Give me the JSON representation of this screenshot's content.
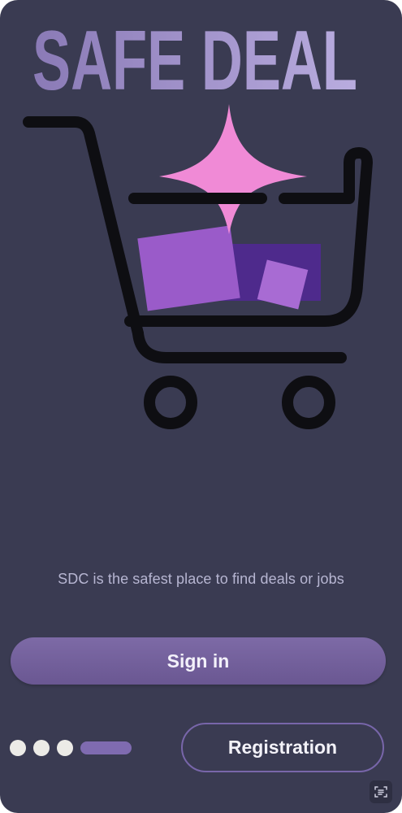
{
  "app": {
    "brand": "SAFE DEAL",
    "brand_first": "SAFE",
    "brand_second": "DEAL"
  },
  "hero": {
    "tagline": "SDC is the safest place to find deals or jobs",
    "illustration": "shopping-cart-with-sparkle-and-boxes"
  },
  "actions": {
    "sign_in_label": "Sign in",
    "registration_label": "Registration"
  },
  "pager": {
    "total_pages": 4,
    "current_page": 4
  },
  "icons": {
    "scan": "scan-text-icon"
  },
  "colors": {
    "background": "#3a3b52",
    "accent": "#7d6aa6",
    "sparkle": "#f08ad6",
    "box": "#9a5bc9"
  }
}
